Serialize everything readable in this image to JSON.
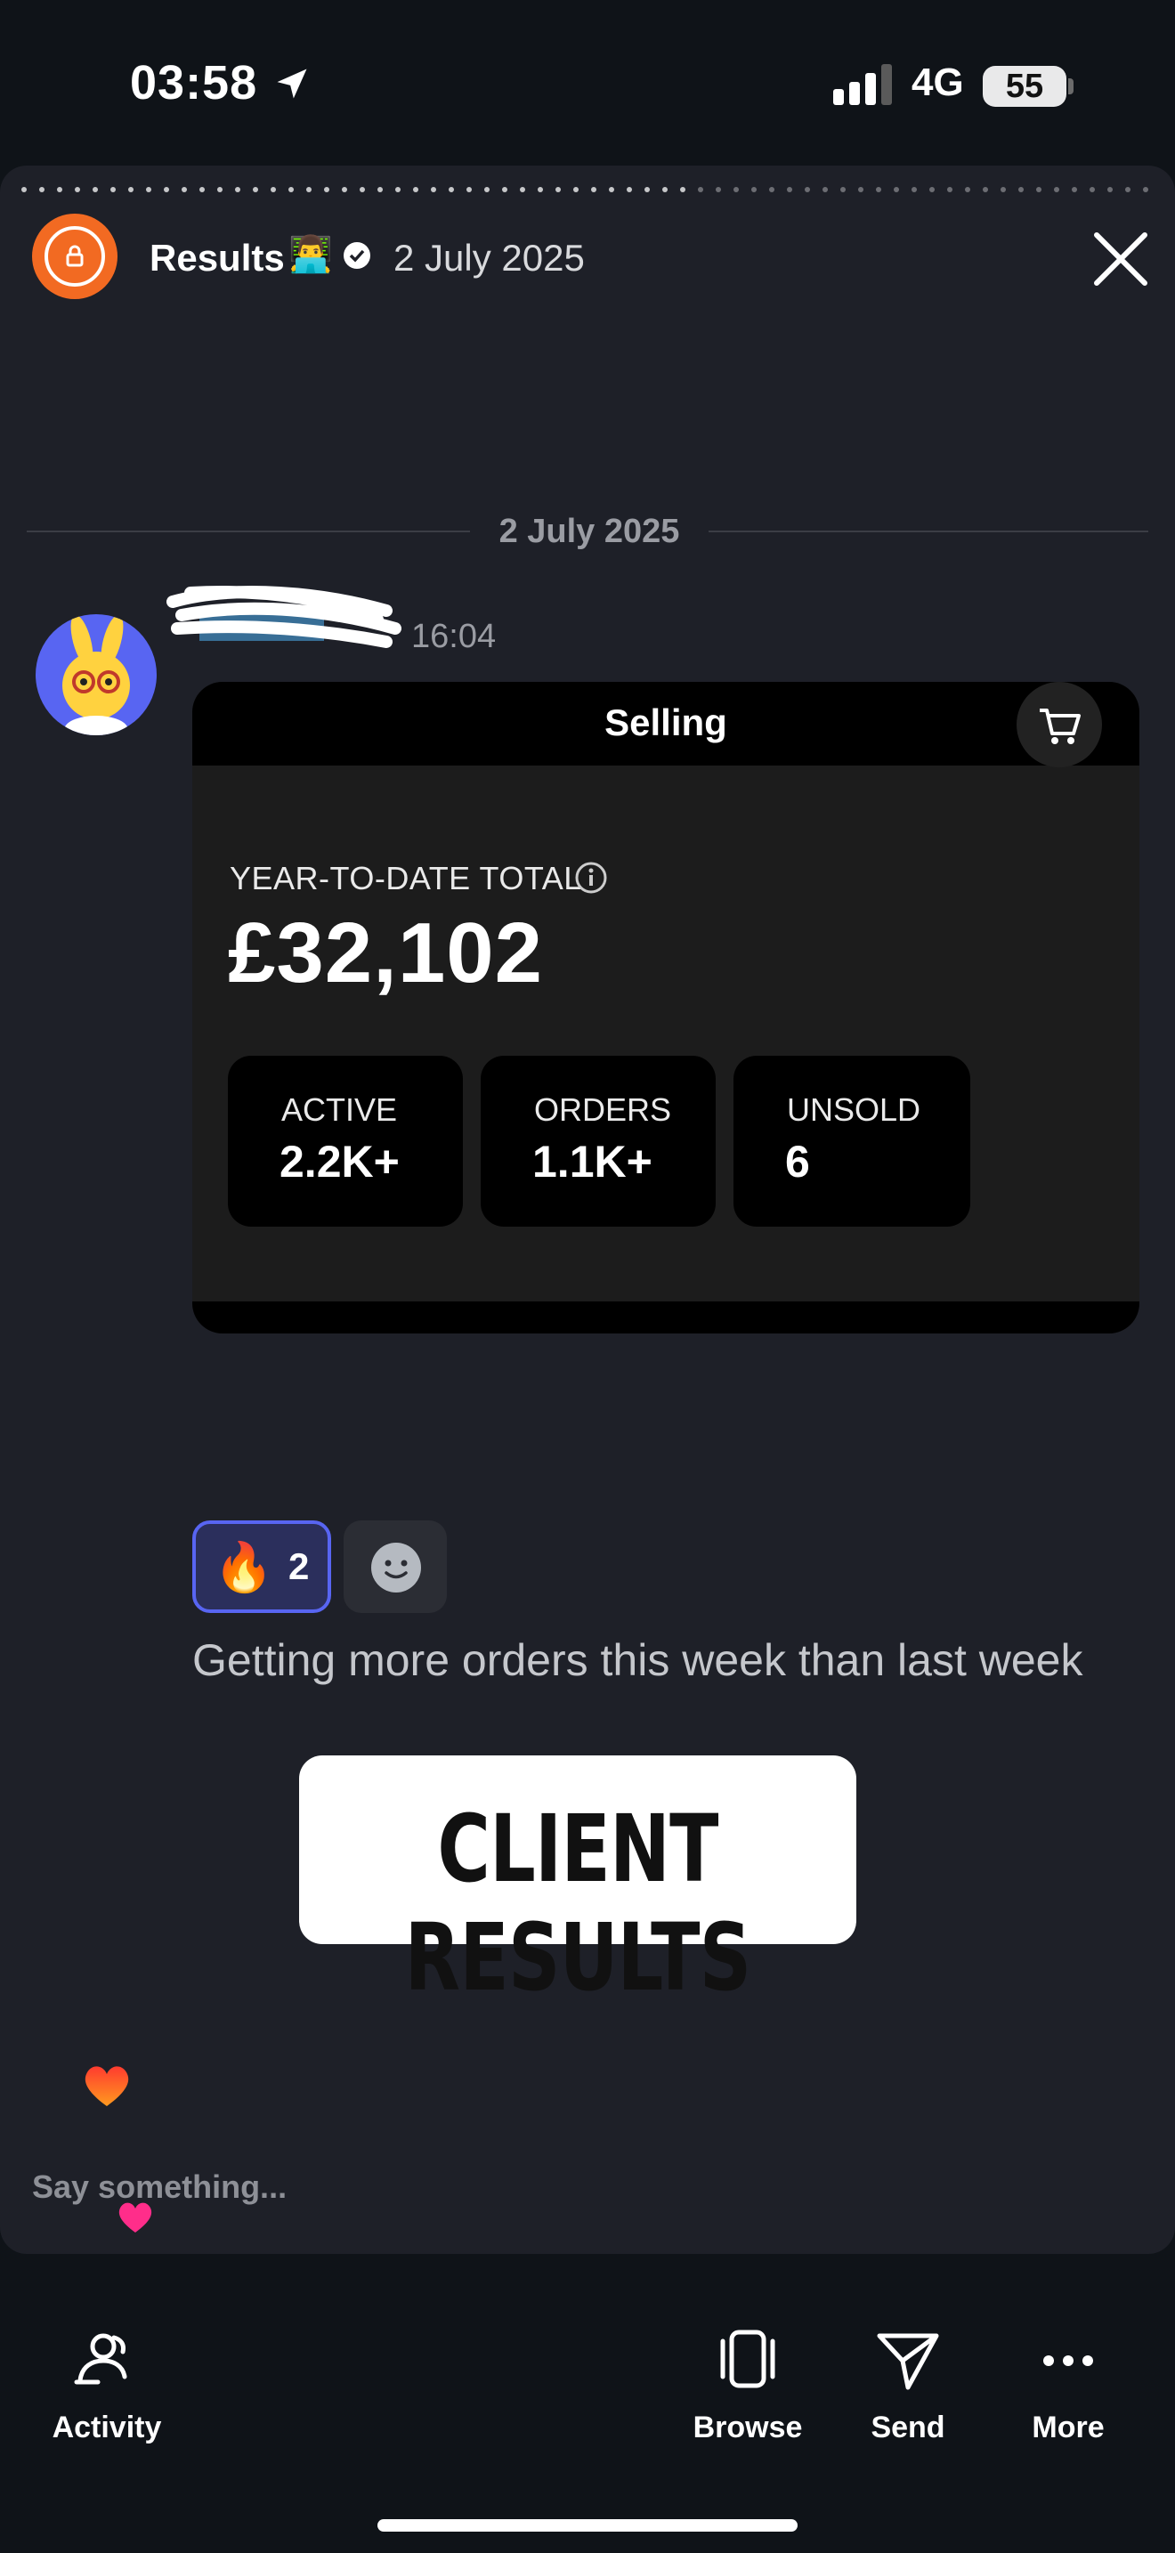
{
  "status_bar": {
    "time": "03:58",
    "network": "4G",
    "battery": "55"
  },
  "story": {
    "title": "Results",
    "title_emoji": "👨‍💻",
    "date": "2 July 2025",
    "close_icon": "close-icon"
  },
  "post": {
    "day_divider": "2 July 2025",
    "author": "",
    "time": "16:04",
    "selling_card": {
      "title": "Selling",
      "ytd_label": "YEAR-TO-DATE TOTAL",
      "ytd_value": "£32,102",
      "stats": [
        {
          "label": "ACTIVE",
          "value": "2.2K+"
        },
        {
          "label": "ORDERS",
          "value": "1.1K+"
        },
        {
          "label": "UNSOLD",
          "value": "6"
        }
      ]
    },
    "reactions": [
      {
        "emoji": "🔥",
        "count": "2"
      }
    ],
    "message": "Getting more orders this week than last week"
  },
  "badge": "CLIENT RESULTS",
  "reply": {
    "placeholder": "Say something..."
  },
  "nav": {
    "activity": "Activity",
    "browse": "Browse",
    "send": "Send",
    "more": "More"
  },
  "colors": {
    "background": "#0f1318",
    "story_bg": "#1e2028",
    "accent": "#5865f2",
    "avatar_orange": "#f26a22"
  }
}
